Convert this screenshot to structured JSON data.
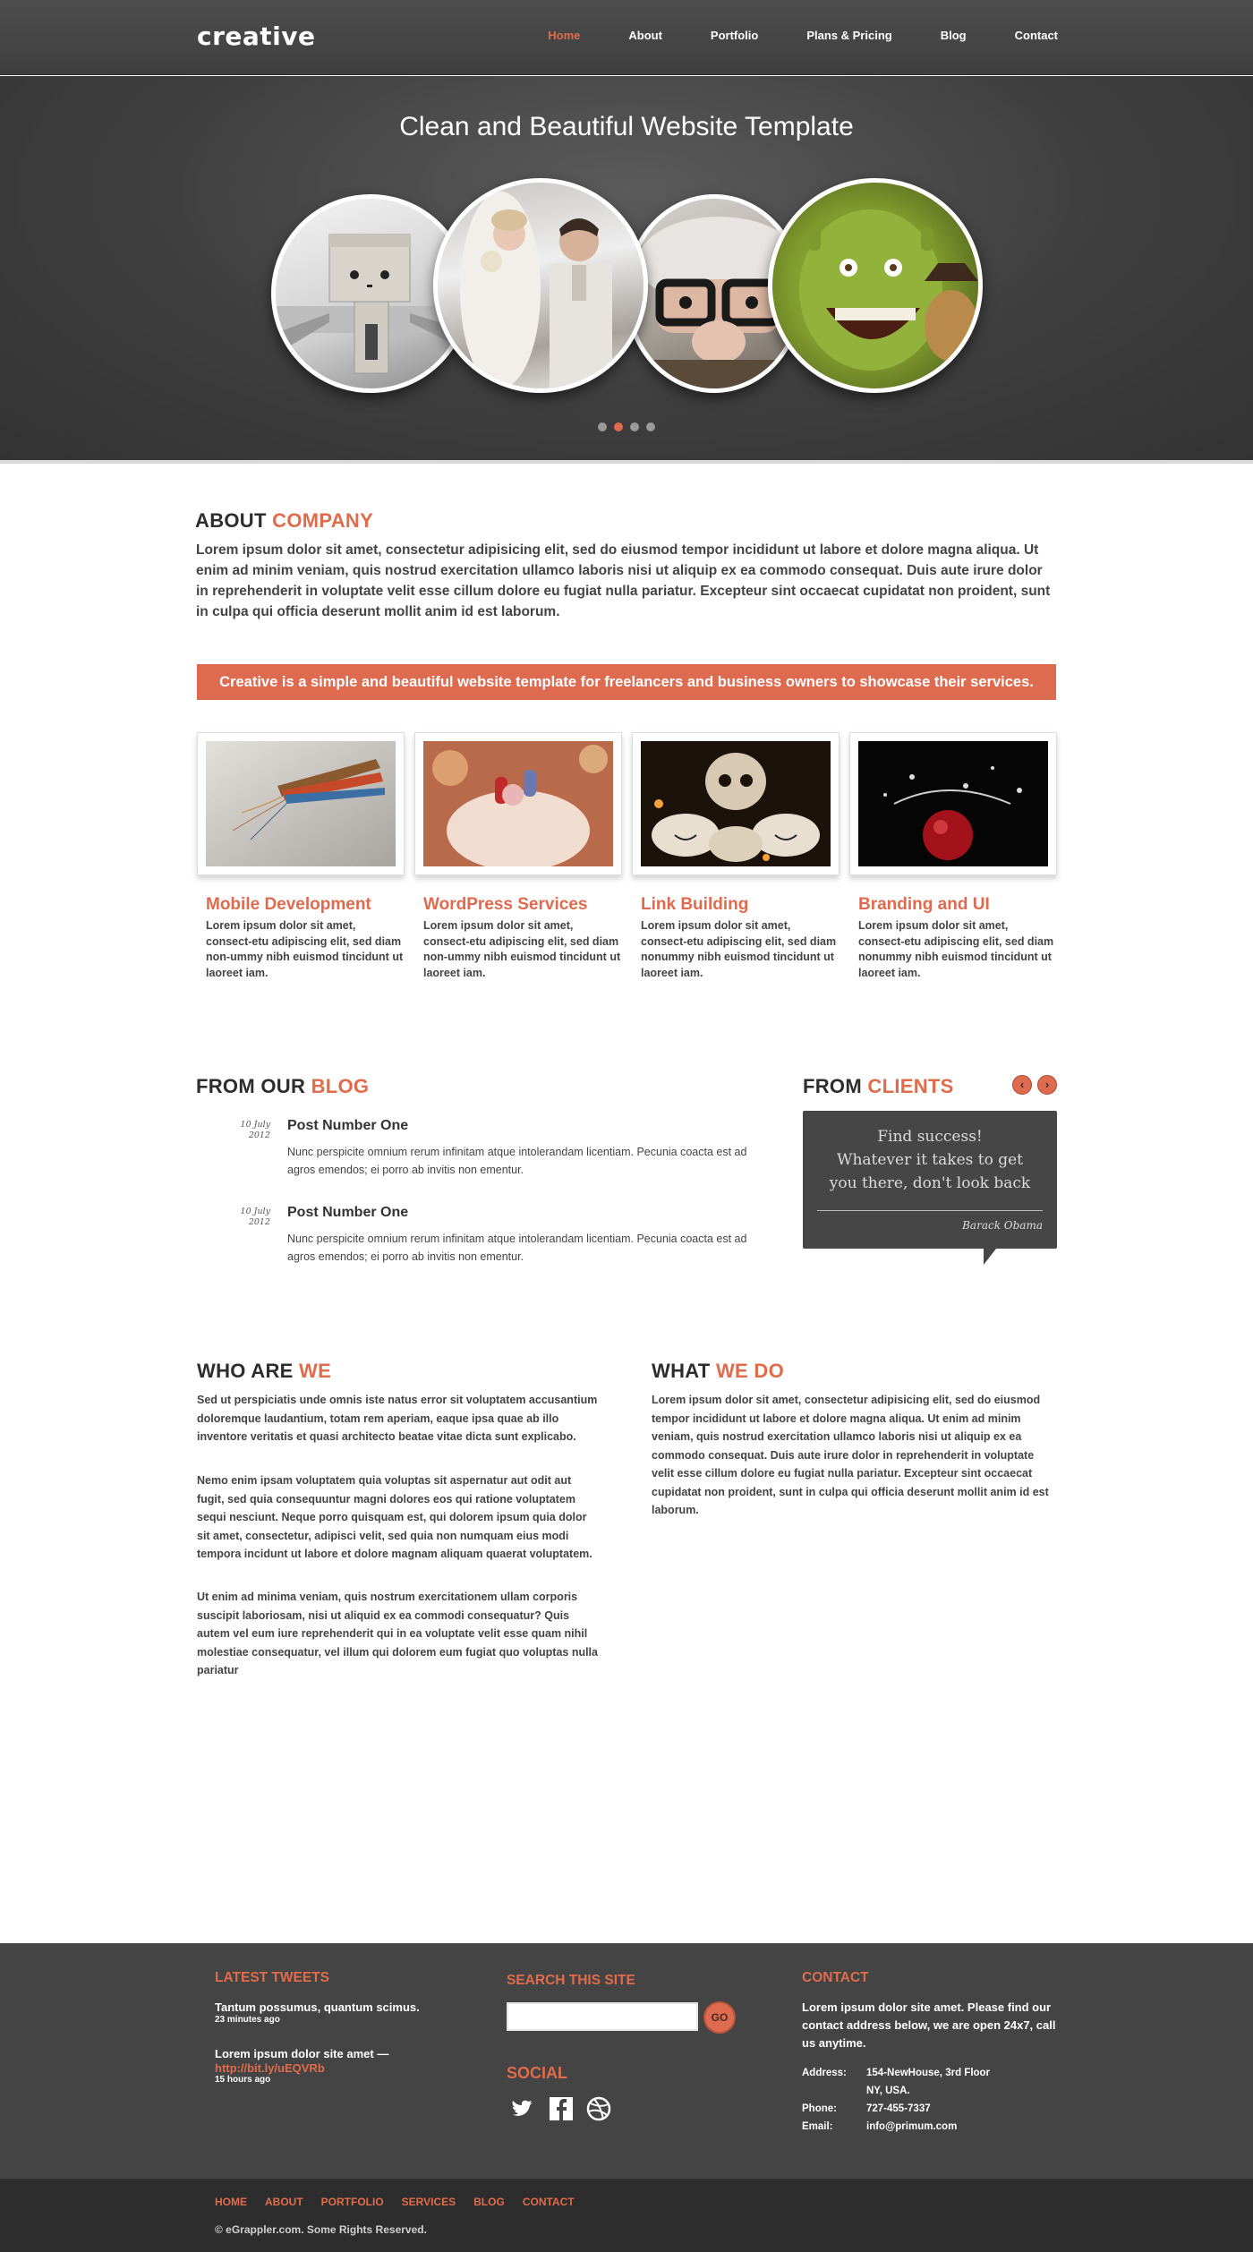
{
  "header": {
    "logo": "creative",
    "nav": [
      "Home",
      "About",
      "Portfolio",
      "Plans & Pricing",
      "Blog",
      "Contact"
    ],
    "active_index": 0
  },
  "hero": {
    "title": "Clean and Beautiful Website Template",
    "slides": [
      "robot-toy-photo",
      "wedding-couple-photo",
      "cartoon-old-man-photo",
      "ogre-cartoon-photo"
    ],
    "active_dot": 1,
    "dot_count": 4
  },
  "about": {
    "heading_prefix": "ABOUT",
    "heading_accent": "COMPANY",
    "text": "Lorem ipsum dolor sit amet, consectetur adipisicing elit, sed do eiusmod tempor incididunt ut labore et dolore magna aliqua. Ut enim ad minim veniam, quis nostrud exercitation ullamco laboris nisi ut aliquip ex ea commodo consequat. Duis aute irure dolor in reprehenderit in voluptate velit esse cillum dolore eu fugiat nulla pariatur. Excepteur sint occaecat cupidatat non proident, sunt in culpa qui officia deserunt mollit anim id est laborum."
  },
  "banner": "Creative is a simple and beautiful website template for freelancers  and business owners to showcase their services.",
  "services": [
    {
      "title": "Mobile Development",
      "text": "Lorem ipsum dolor sit amet, consect-etu adipiscing elit, sed diam non-ummy nibh euismod tincidunt ut laoreet iam."
    },
    {
      "title": "WordPress Services",
      "text": "Lorem ipsum dolor sit amet, consect-etu adipiscing elit, sed diam non-ummy nibh euismod tincidunt ut laoreet iam."
    },
    {
      "title": "Link Building",
      "text": "Lorem ipsum dolor sit amet, consect-etu adipiscing elit, sed diam nonummy nibh euismod tincidunt ut laoreet iam."
    },
    {
      "title": "Branding and UI",
      "text": "Lorem ipsum dolor sit amet, consect-etu adipiscing elit, sed diam nonummy nibh euismod tincidunt ut laoreet iam."
    }
  ],
  "blog": {
    "heading_prefix": "FROM OUR",
    "heading_accent": "BLOG",
    "posts": [
      {
        "date_day": "10 July",
        "date_year": "2012",
        "title": "Post Number One",
        "body": "Nunc perspicite omnium rerum infinitam atque intolerandam licentiam. Pecunia coacta est ad agros emendos; ei porro ab invitis non ementur."
      },
      {
        "date_day": "10 July",
        "date_year": "2012",
        "title": "Post Number One",
        "body": "Nunc perspicite omnium rerum infinitam atque intolerandam licentiam. Pecunia coacta est ad agros emendos; ei porro ab invitis non ementur."
      }
    ]
  },
  "clients": {
    "heading_prefix": "FROM",
    "heading_accent": "CLIENTS",
    "prev": "‹",
    "next": "›",
    "quote": "Find success!\nWhatever it takes to get you there, don't look back",
    "author": "Barack Obama"
  },
  "who": {
    "heading_prefix": "WHO ARE",
    "heading_accent": "WE",
    "paragraphs": [
      "Sed ut perspiciatis unde omnis iste natus error sit voluptatem accusantium doloremque laudantium, totam rem aperiam, eaque ipsa quae ab illo inventore veritatis et quasi architecto beatae vitae dicta sunt explicabo.",
      "Nemo enim ipsam voluptatem quia voluptas sit aspernatur aut odit aut fugit, sed quia consequuntur magni dolores eos qui ratione voluptatem sequi nesciunt. Neque porro quisquam est, qui dolorem ipsum quia dolor sit amet, consectetur, adipisci velit, sed quia non numquam eius modi tempora incidunt ut labore et dolore magnam aliquam quaerat voluptatem.",
      "Ut enim ad minima veniam, quis nostrum exercitationem ullam corporis suscipit laboriosam, nisi ut aliquid ex ea commodi consequatur? Quis autem vel eum iure reprehenderit qui in ea voluptate velit esse quam nihil molestiae consequatur, vel illum qui dolorem eum fugiat quo voluptas nulla pariatur"
    ]
  },
  "what": {
    "heading_prefix": "WHAT",
    "heading_accent": "WE DO",
    "text": "Lorem ipsum dolor sit amet, consectetur adipisicing elit, sed do eiusmod tempor incididunt ut labore et dolore magna aliqua. Ut enim ad minim veniam, quis nostrud exercitation ullamco laboris nisi ut aliquip ex ea commodo consequat. Duis aute irure dolor in reprehenderit in voluptate velit esse cillum dolore eu fugiat nulla pariatur. Excepteur sint occaecat cupidatat non proident, sunt in culpa qui officia deserunt mollit anim id est laborum."
  },
  "footer": {
    "tweets_heading": "LATEST TWEETS",
    "tweets": [
      {
        "text": "Tantum possumus, quantum scimus.",
        "link": "",
        "time": "23 minutes ago"
      },
      {
        "text": "Lorem ipsum dolor site amet —",
        "link": "http://bit.ly/uEQVRb",
        "time": "15 hours ago"
      }
    ],
    "search_heading": "SEARCH THIS SITE",
    "search_placeholder": "",
    "search_button": "GO",
    "social_heading": "SOCIAL",
    "social_icons": [
      "twitter-icon",
      "facebook-icon",
      "dribbble-icon"
    ],
    "contact_heading": "CONTACT",
    "contact_intro": "Lorem ipsum dolor site amet. Please find our contact address below, we are open 24x7, call us anytime.",
    "address_label": "Address:",
    "address_line1": "154-NewHouse, 3rd Floor",
    "address_line2": "NY, USA.",
    "phone_label": "Phone:",
    "phone": "727-455-7337",
    "email_label": "Email:",
    "email": "info@primum.com",
    "bottom_nav": [
      "HOME",
      "ABOUT",
      "PORTFOLIO",
      "SERVICES",
      "BLOG",
      "CONTACT"
    ],
    "copyright": "© eGrappler.com. Some Rights Reserved."
  },
  "colors": {
    "accent": "#de6b4f",
    "header_bg": "#474747",
    "footer_bg": "#444444",
    "bottom_bar_bg": "#2d2d2d"
  }
}
